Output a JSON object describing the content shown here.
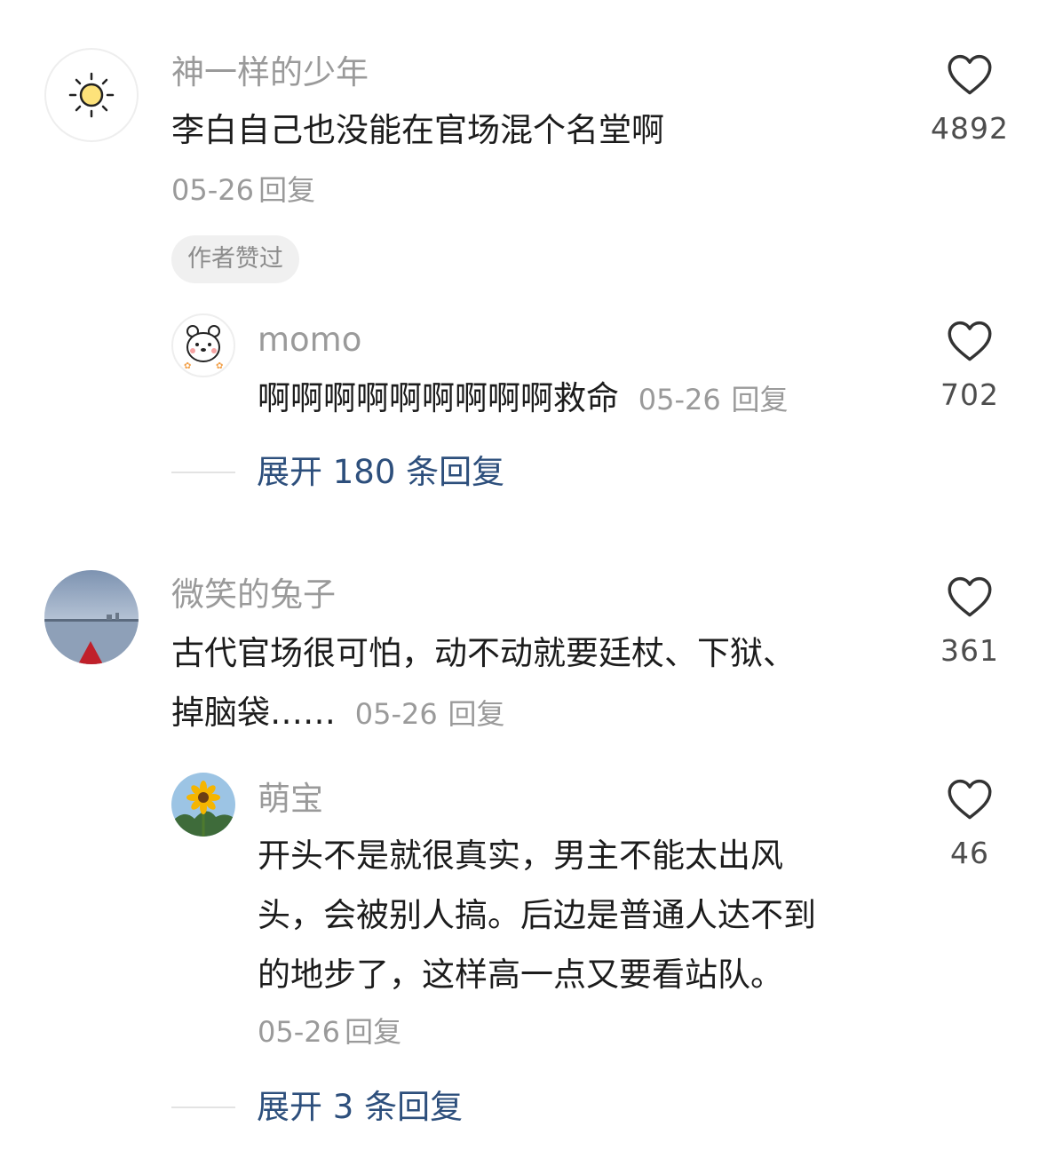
{
  "comments": [
    {
      "username": "神一样的少年",
      "text": "李白自己也没能在官场混个名堂啊",
      "date": "05-26",
      "reply_label": "回复",
      "badge": "作者赞过",
      "likes": "4892",
      "avatar_icon": "sun-icon",
      "replies": [
        {
          "username": "momo",
          "text": "啊啊啊啊啊啊啊啊啊救命",
          "date": "05-26",
          "reply_label": "回复",
          "likes": "702",
          "avatar_icon": "bear-avatar"
        }
      ],
      "expand_label": "展开 180 条回复"
    },
    {
      "username": "微笑的兔子",
      "text_lines": [
        "古代官场很可怕，动不动就要廷杖、下狱、",
        "掉脑袋……"
      ],
      "date": "05-26",
      "reply_label": "回复",
      "likes": "361",
      "avatar_icon": "lake-avatar",
      "replies": [
        {
          "username": "萌宝",
          "text_lines": [
            "开头不是就很真实，男主不能太出风",
            "头，会被别人搞。后边是普通人达不到",
            "的地步了，这样高一点又要看站队。"
          ],
          "date": "05-26",
          "reply_label": "回复",
          "likes": "46",
          "avatar_icon": "sunflower-avatar"
        }
      ],
      "expand_label": "展开 3 条回复"
    }
  ],
  "colors": {
    "name": "#9a9a9a",
    "text": "#1c1c1c",
    "link": "#2d4f7c",
    "badge_bg": "#f0f0f0"
  },
  "icons": {
    "like": "heart-outline-icon"
  }
}
